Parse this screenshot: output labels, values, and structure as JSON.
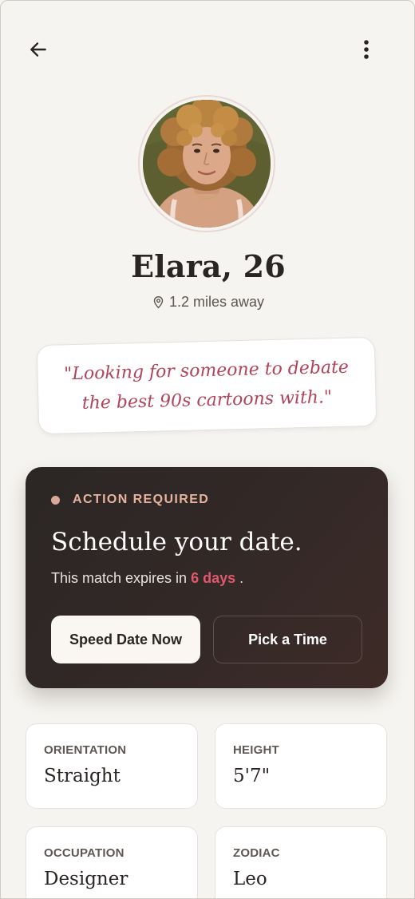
{
  "profile": {
    "name_age": "Elara, 26",
    "distance": "1.2 miles away",
    "quote": "\"Looking for someone to debate the best 90s cartoons with.\""
  },
  "action": {
    "label": "ACTION REQUIRED",
    "title": "Schedule your date.",
    "expires_prefix": "This match expires in",
    "expires_days": "6 days",
    "expires_suffix": ".",
    "primary_button": "Speed Date Now",
    "secondary_button": "Pick a Time"
  },
  "details": [
    {
      "label": "ORIENTATION",
      "value": "Straight"
    },
    {
      "label": "HEIGHT",
      "value": "5'7\""
    },
    {
      "label": "OCCUPATION",
      "value": "Designer"
    },
    {
      "label": "ZODIAC",
      "value": "Leo"
    }
  ],
  "icons": {
    "back": "arrow-left-icon",
    "menu": "more-vertical-icon",
    "location": "map-pin-icon"
  },
  "colors": {
    "background": "#f6f4f0",
    "quote_text": "#b1435a",
    "card_dark": "#2b2624",
    "accent_label": "#e8b49f",
    "expires_highlight": "#e0586c"
  }
}
